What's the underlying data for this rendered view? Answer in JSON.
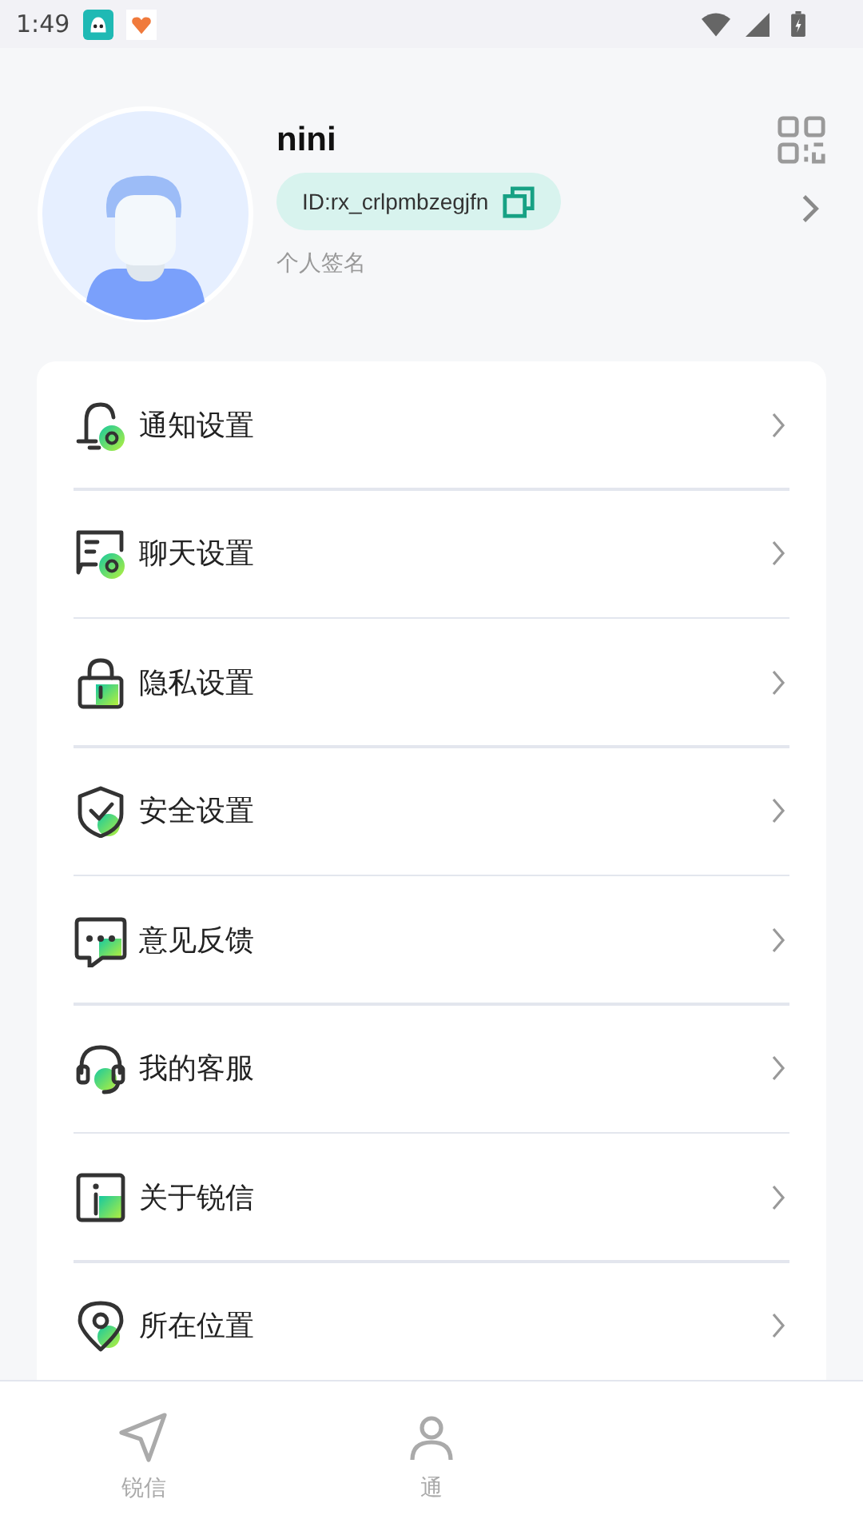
{
  "status_bar": {
    "time": "1:49"
  },
  "profile": {
    "name": "nini",
    "id": "ID:rx_crlpmbzegjfn",
    "signature": "个人签名"
  },
  "menu": [
    {
      "kind": "bell",
      "label": "通知设置"
    },
    {
      "kind": "chat",
      "label": "聊天设置"
    },
    {
      "kind": "lock",
      "label": "隐私设置"
    },
    {
      "kind": "shield",
      "label": "安全设置"
    },
    {
      "kind": "feedback",
      "label": "意见反馈"
    },
    {
      "kind": "headset",
      "label": "我的客服"
    },
    {
      "kind": "info",
      "label": "关于锐信"
    },
    {
      "kind": "location",
      "label": "所在位置"
    }
  ],
  "tabs": [
    {
      "kind": "send",
      "label": "锐信",
      "selected": false
    },
    {
      "kind": "contacts",
      "label": "通",
      "selected": false
    }
  ]
}
